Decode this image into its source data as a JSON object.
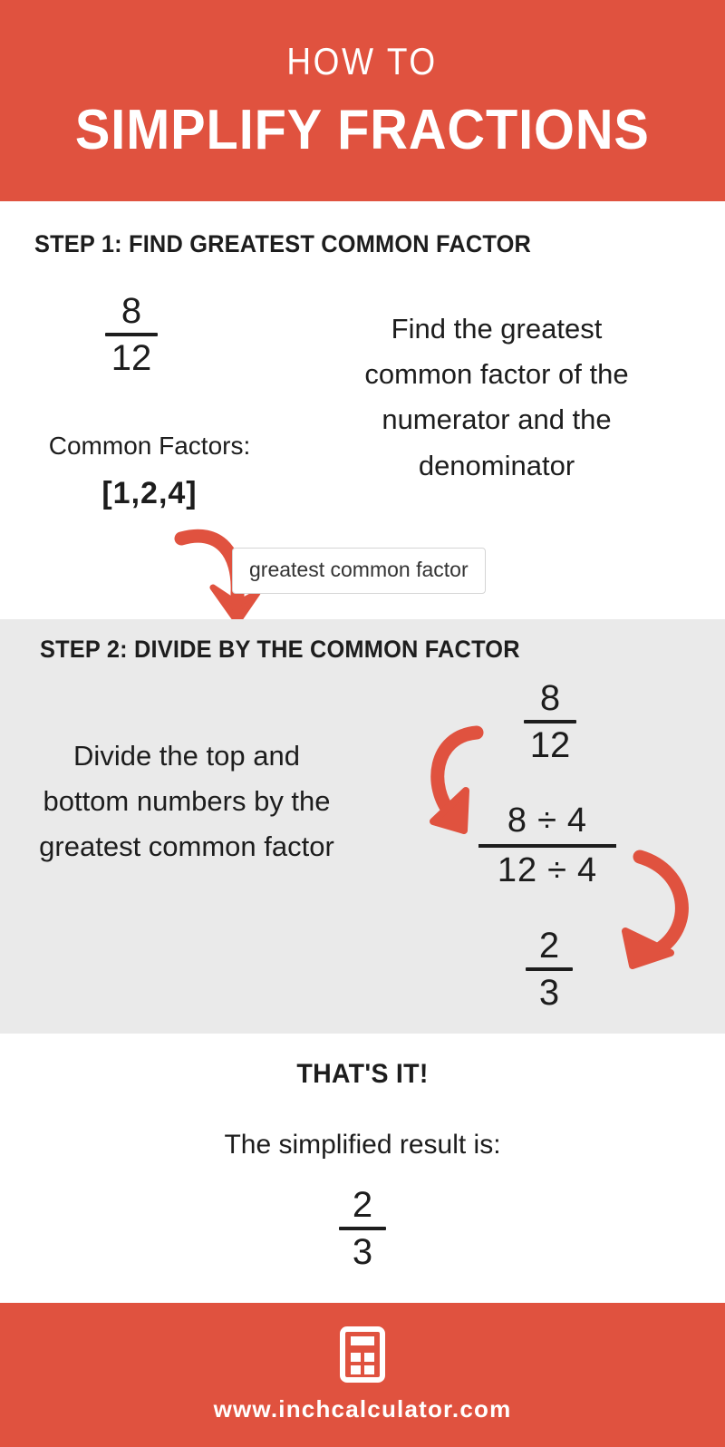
{
  "header": {
    "kicker": "HOW TO",
    "title": "SIMPLIFY FRACTIONS",
    "bg_color": "#e0523f",
    "text_color": "#ffffff"
  },
  "step1": {
    "heading": "STEP 1: FIND GREATEST COMMON FACTOR",
    "fraction": {
      "numerator": "8",
      "denominator": "12"
    },
    "common_factors_label": "Common Factors:",
    "common_factors_value": "[1,2,4]",
    "tooltip": "greatest common factor",
    "description": "Find the greatest common factor of the numerator and the denominator",
    "arrow_curve_name": "curved-down-arrow",
    "arrow_point_name": "diagonal-up-left-arrow",
    "bg_color": "#ffffff"
  },
  "step2": {
    "heading": "STEP 2: DIVIDE BY THE COMMON FACTOR",
    "description": "Divide the top and bottom numbers by the greatest common factor",
    "fraction_start": {
      "numerator": "8",
      "denominator": "12"
    },
    "division": {
      "numerator_left": "8",
      "operator": "÷",
      "numerator_right": "4",
      "denominator_left": "12",
      "denominator_right": "4"
    },
    "fraction_result": {
      "numerator": "2",
      "denominator": "3"
    },
    "bg_color": "#eaeaea"
  },
  "conclusion": {
    "title": "THAT'S IT!",
    "subtitle": "The simplified result is:",
    "fraction": {
      "numerator": "2",
      "denominator": "3"
    }
  },
  "footer": {
    "icon": "calculator-icon",
    "url": "www.inchcalculator.com",
    "bg_color": "#e0523f",
    "text_color": "#ffffff"
  },
  "colors": {
    "brand_red": "#e0523f",
    "ink": "#1d1d1d",
    "panel_gray": "#eaeaea",
    "white": "#ffffff"
  }
}
